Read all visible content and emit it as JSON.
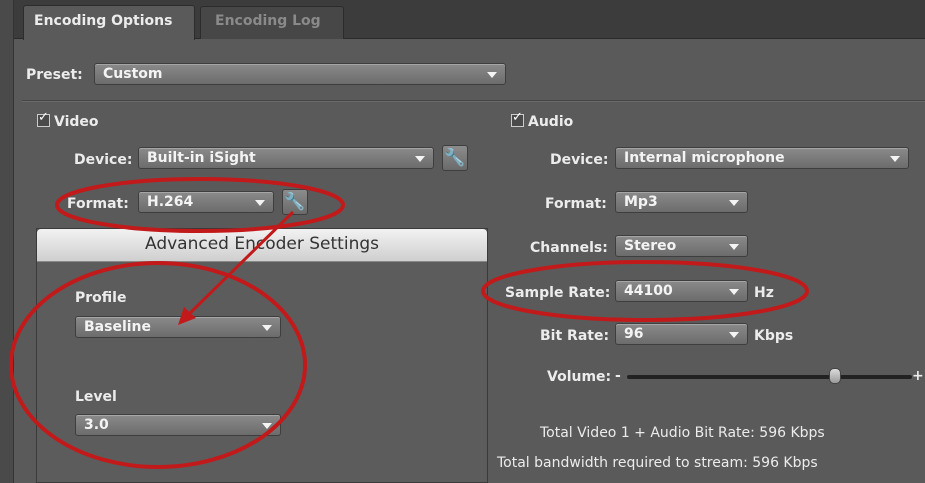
{
  "tabs": [
    {
      "label": "Encoding Options"
    },
    {
      "label": "Encoding Log"
    }
  ],
  "preset": {
    "label": "Preset:",
    "value": "Custom"
  },
  "video": {
    "header": "Video",
    "device_label": "Device:",
    "device_value": "Built-in iSight",
    "format_label": "Format:",
    "format_value": "H.264"
  },
  "advanced": {
    "title": "Advanced Encoder Settings",
    "profile_label": "Profile",
    "profile_value": "Baseline",
    "level_label": "Level",
    "level_value": "3.0"
  },
  "audio": {
    "header": "Audio",
    "device_label": "Device:",
    "device_value": "Internal microphone",
    "format_label": "Format:",
    "format_value": "Mp3",
    "channels_label": "Channels:",
    "channels_value": "Stereo",
    "sample_rate_label": "Sample Rate:",
    "sample_rate_value": "44100",
    "sample_rate_unit": "Hz",
    "bit_rate_label": "Bit Rate:",
    "bit_rate_value": "96",
    "bit_rate_unit": "Kbps",
    "volume_label": "Volume:",
    "volume_minus": "-",
    "volume_plus": "+",
    "volume_level": 0.73
  },
  "totals": {
    "total_bit_rate": "Total Video 1 + Audio Bit Rate: 596 Kbps",
    "bandwidth": "Total bandwidth required to stream: 596 Kbps"
  },
  "colors": {
    "annotation_red": "#c21a1a",
    "panel_bg": "#5a5a5a",
    "tab_active": "#6e6e6e"
  },
  "icons": {
    "wrench": "wrench-icon",
    "dropdown": "chevron-down-icon",
    "checkbox": "checkmark-icon"
  }
}
